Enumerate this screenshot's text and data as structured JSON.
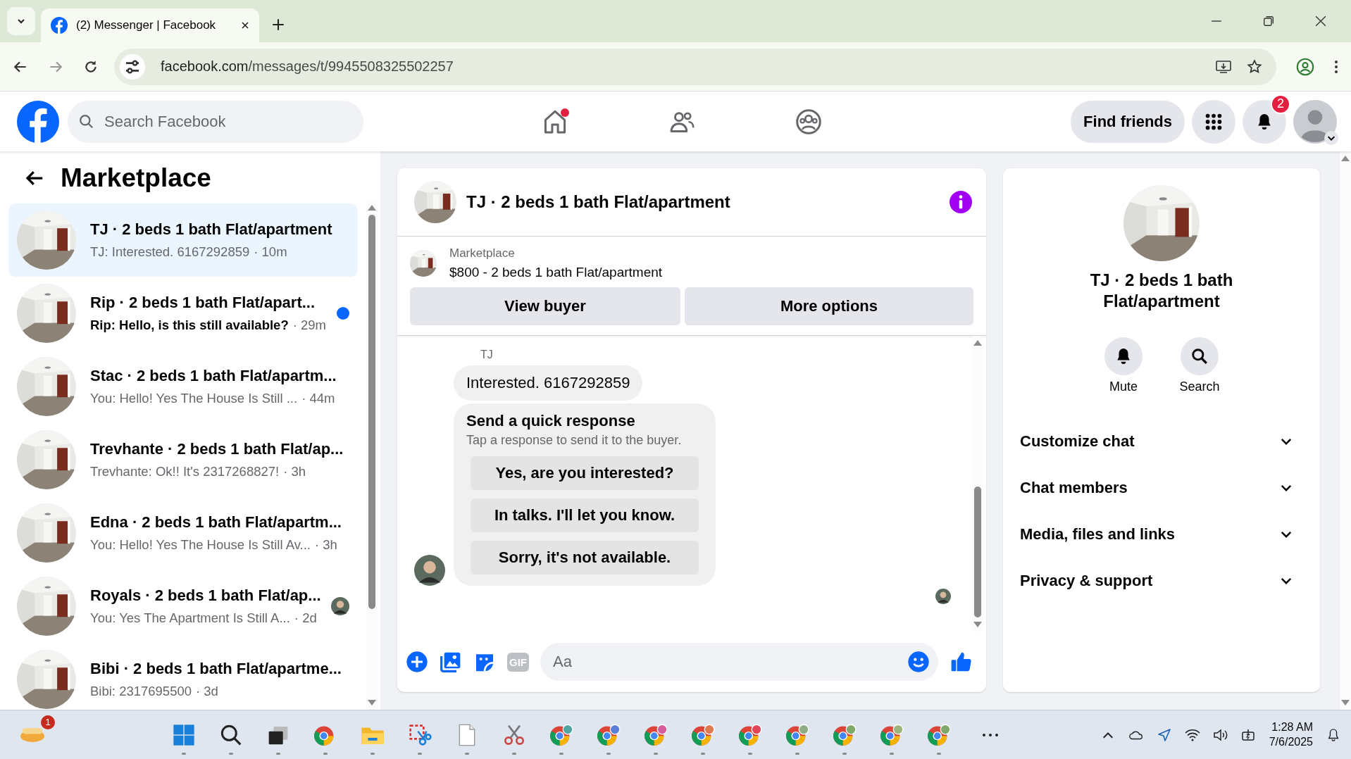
{
  "browser": {
    "tab": {
      "title": "(2) Messenger | Facebook",
      "selected": true
    },
    "url": {
      "host": "facebook.com",
      "path": "/messages/t/9945508325502257"
    }
  },
  "header": {
    "search": {
      "placeholder": "Search Facebook"
    },
    "nav": [
      {
        "kind": "home",
        "dot": true
      },
      {
        "kind": "friends",
        "dot": false
      },
      {
        "kind": "groups",
        "dot": false
      }
    ],
    "find_friends": "Find friends",
    "notifications": "2"
  },
  "left": {
    "title": "Marketplace",
    "conversations": [
      {
        "title": "TJ · 2 beds 1 bath Flat/apartment",
        "preview": "TJ: Interested. 6167292859",
        "time": "· 10m",
        "selected": true,
        "unread": false,
        "seen": false
      },
      {
        "title": "Rip · 2 beds 1 bath Flat/apart...",
        "preview": "Rip: Hello, is this still available?",
        "time": "· 29m",
        "selected": false,
        "unread": true,
        "seen": false
      },
      {
        "title": "Stac · 2 beds 1 bath Flat/apartm...",
        "preview": "You: Hello! Yes The House Is Still ...",
        "time": "· 44m",
        "selected": false,
        "unread": false,
        "seen": false
      },
      {
        "title": "Trevhante · 2 beds 1 bath Flat/ap...",
        "preview": "Trevhante: Ok!! It's 2317268827!",
        "time": "· 3h",
        "selected": false,
        "unread": false,
        "seen": false
      },
      {
        "title": "Edna · 2 beds 1 bath Flat/apartm...",
        "preview": "You: Hello! Yes The House Is Still Av...",
        "time": "· 3h",
        "selected": false,
        "unread": false,
        "seen": false
      },
      {
        "title": "Royals · 2 beds 1 bath Flat/ap...",
        "preview": "You: Yes The Apartment Is Still A...",
        "time": "· 2d",
        "selected": false,
        "unread": false,
        "seen": true
      },
      {
        "title": "Bibi · 2 beds 1 bath Flat/apartme...",
        "preview": "Bibi: 2317695500",
        "time": "· 3d",
        "selected": false,
        "unread": false,
        "seen": false
      }
    ]
  },
  "chat": {
    "title": "TJ · 2 beds 1 bath Flat/apartment",
    "listing": {
      "label": "Marketplace",
      "title": "$800 - 2 beds 1 bath Flat/apartment",
      "buttons": [
        "View buyer",
        "More options"
      ]
    },
    "sender": "TJ",
    "message": "Interested. 6167292859",
    "quick": {
      "title": "Send a quick response",
      "subtitle": "Tap a response to send it to the buyer.",
      "options": [
        "Yes, are you interested?",
        "In talks. I'll let you know.",
        "Sorry, it's not available."
      ]
    },
    "composer": {
      "gif": "GIF",
      "placeholder": "Aa"
    }
  },
  "details": {
    "title": "TJ · 2 beds 1 bath Flat/apartment",
    "actions": [
      {
        "kind": "mute",
        "label": "Mute"
      },
      {
        "kind": "search",
        "label": "Search"
      }
    ],
    "sections": [
      "Customize chat",
      "Chat members",
      "Media, files and links",
      "Privacy & support"
    ]
  },
  "taskbar": {
    "widgets_badge": "1",
    "apps": [
      {
        "kind": "start"
      },
      {
        "kind": "search"
      },
      {
        "kind": "taskview"
      },
      {
        "kind": "chrome"
      },
      {
        "kind": "folder"
      },
      {
        "kind": "snip"
      },
      {
        "kind": "file"
      },
      {
        "kind": "scissors"
      },
      {
        "kind": "profile",
        "color": "#4fa6a0"
      },
      {
        "kind": "profile",
        "color": "#5b7fd6"
      },
      {
        "kind": "profile",
        "color": "#d65b9a"
      },
      {
        "kind": "profile",
        "color": "#e07a4f"
      },
      {
        "kind": "profile",
        "color": "#e0455a"
      },
      {
        "kind": "profile",
        "color": "#8fae88"
      },
      {
        "kind": "profile",
        "color": "#7fa86a"
      },
      {
        "kind": "profile",
        "color": "#9bb57a"
      },
      {
        "kind": "profile",
        "color": "#7fa86a"
      }
    ],
    "time": "1:28 AM",
    "date": "7/6/2025"
  }
}
